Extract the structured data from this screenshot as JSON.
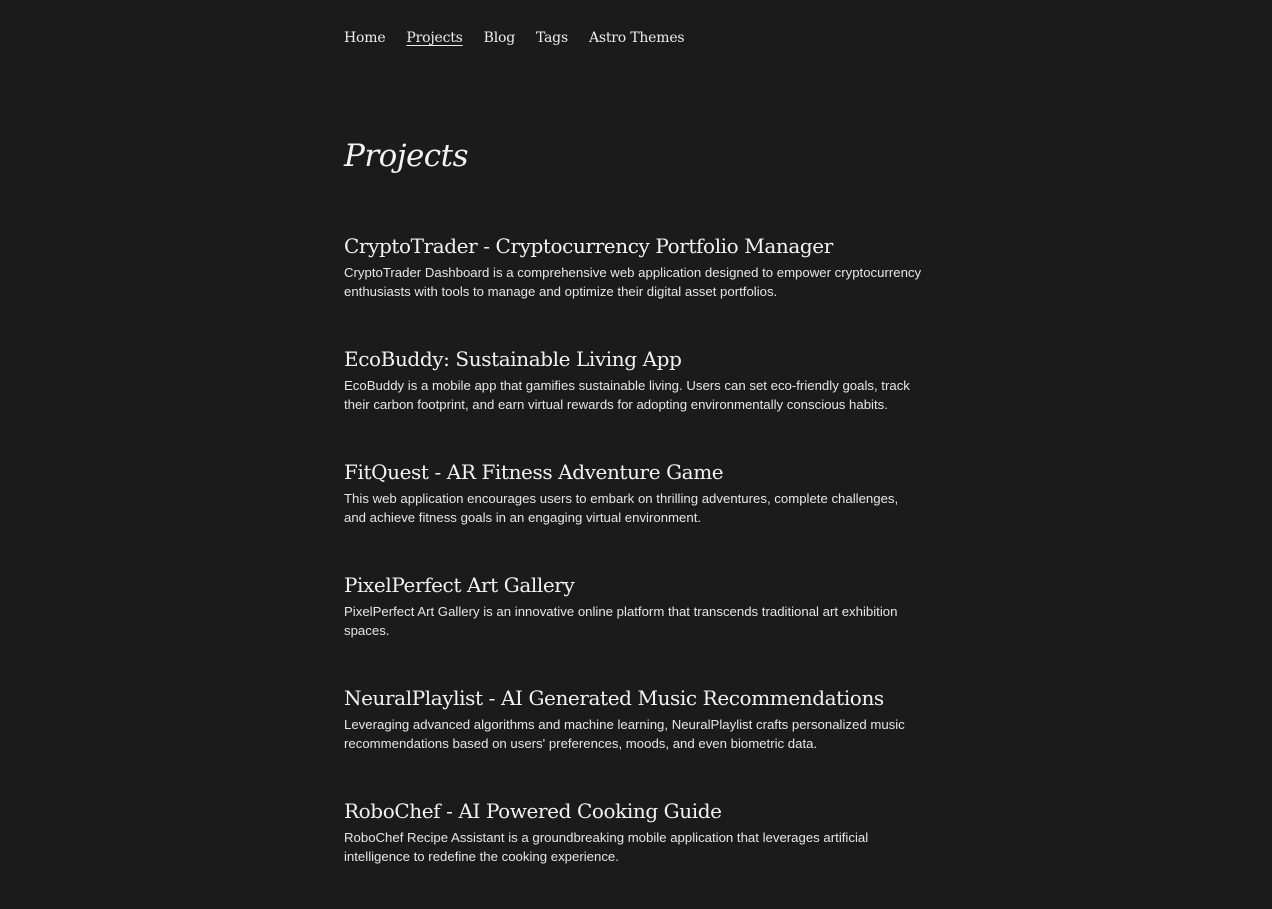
{
  "nav": {
    "items": [
      {
        "label": "Home",
        "active": false
      },
      {
        "label": "Projects",
        "active": true
      },
      {
        "label": "Blog",
        "active": false
      },
      {
        "label": "Tags",
        "active": false
      },
      {
        "label": "Astro Themes",
        "active": false
      }
    ]
  },
  "page": {
    "title": "Projects"
  },
  "projects": [
    {
      "title": "CryptoTrader - Cryptocurrency Portfolio Manager",
      "description": "CryptoTrader Dashboard is a comprehensive web application designed to empower cryptocurrency enthusiasts with tools to manage and optimize their digital asset portfolios."
    },
    {
      "title": "EcoBuddy: Sustainable Living App",
      "description": "EcoBuddy is a mobile app that gamifies sustainable living. Users can set eco-friendly goals, track their carbon footprint, and earn virtual rewards for adopting environmentally conscious habits."
    },
    {
      "title": "FitQuest - AR Fitness Adventure Game",
      "description": "This web application encourages users to embark on thrilling adventures, complete challenges, and achieve fitness goals in an engaging virtual environment."
    },
    {
      "title": "PixelPerfect Art Gallery",
      "description": "PixelPerfect Art Gallery is an innovative online platform that transcends traditional art exhibition spaces."
    },
    {
      "title": "NeuralPlaylist - AI Generated Music Recommendations",
      "description": "Leveraging advanced algorithms and machine learning, NeuralPlaylist crafts personalized music recommendations based on users' preferences, moods, and even biometric data."
    },
    {
      "title": "RoboChef - AI Powered Cooking Guide",
      "description": "RoboChef Recipe Assistant is a groundbreaking mobile application that leverages artificial intelligence to redefine the cooking experience."
    }
  ]
}
